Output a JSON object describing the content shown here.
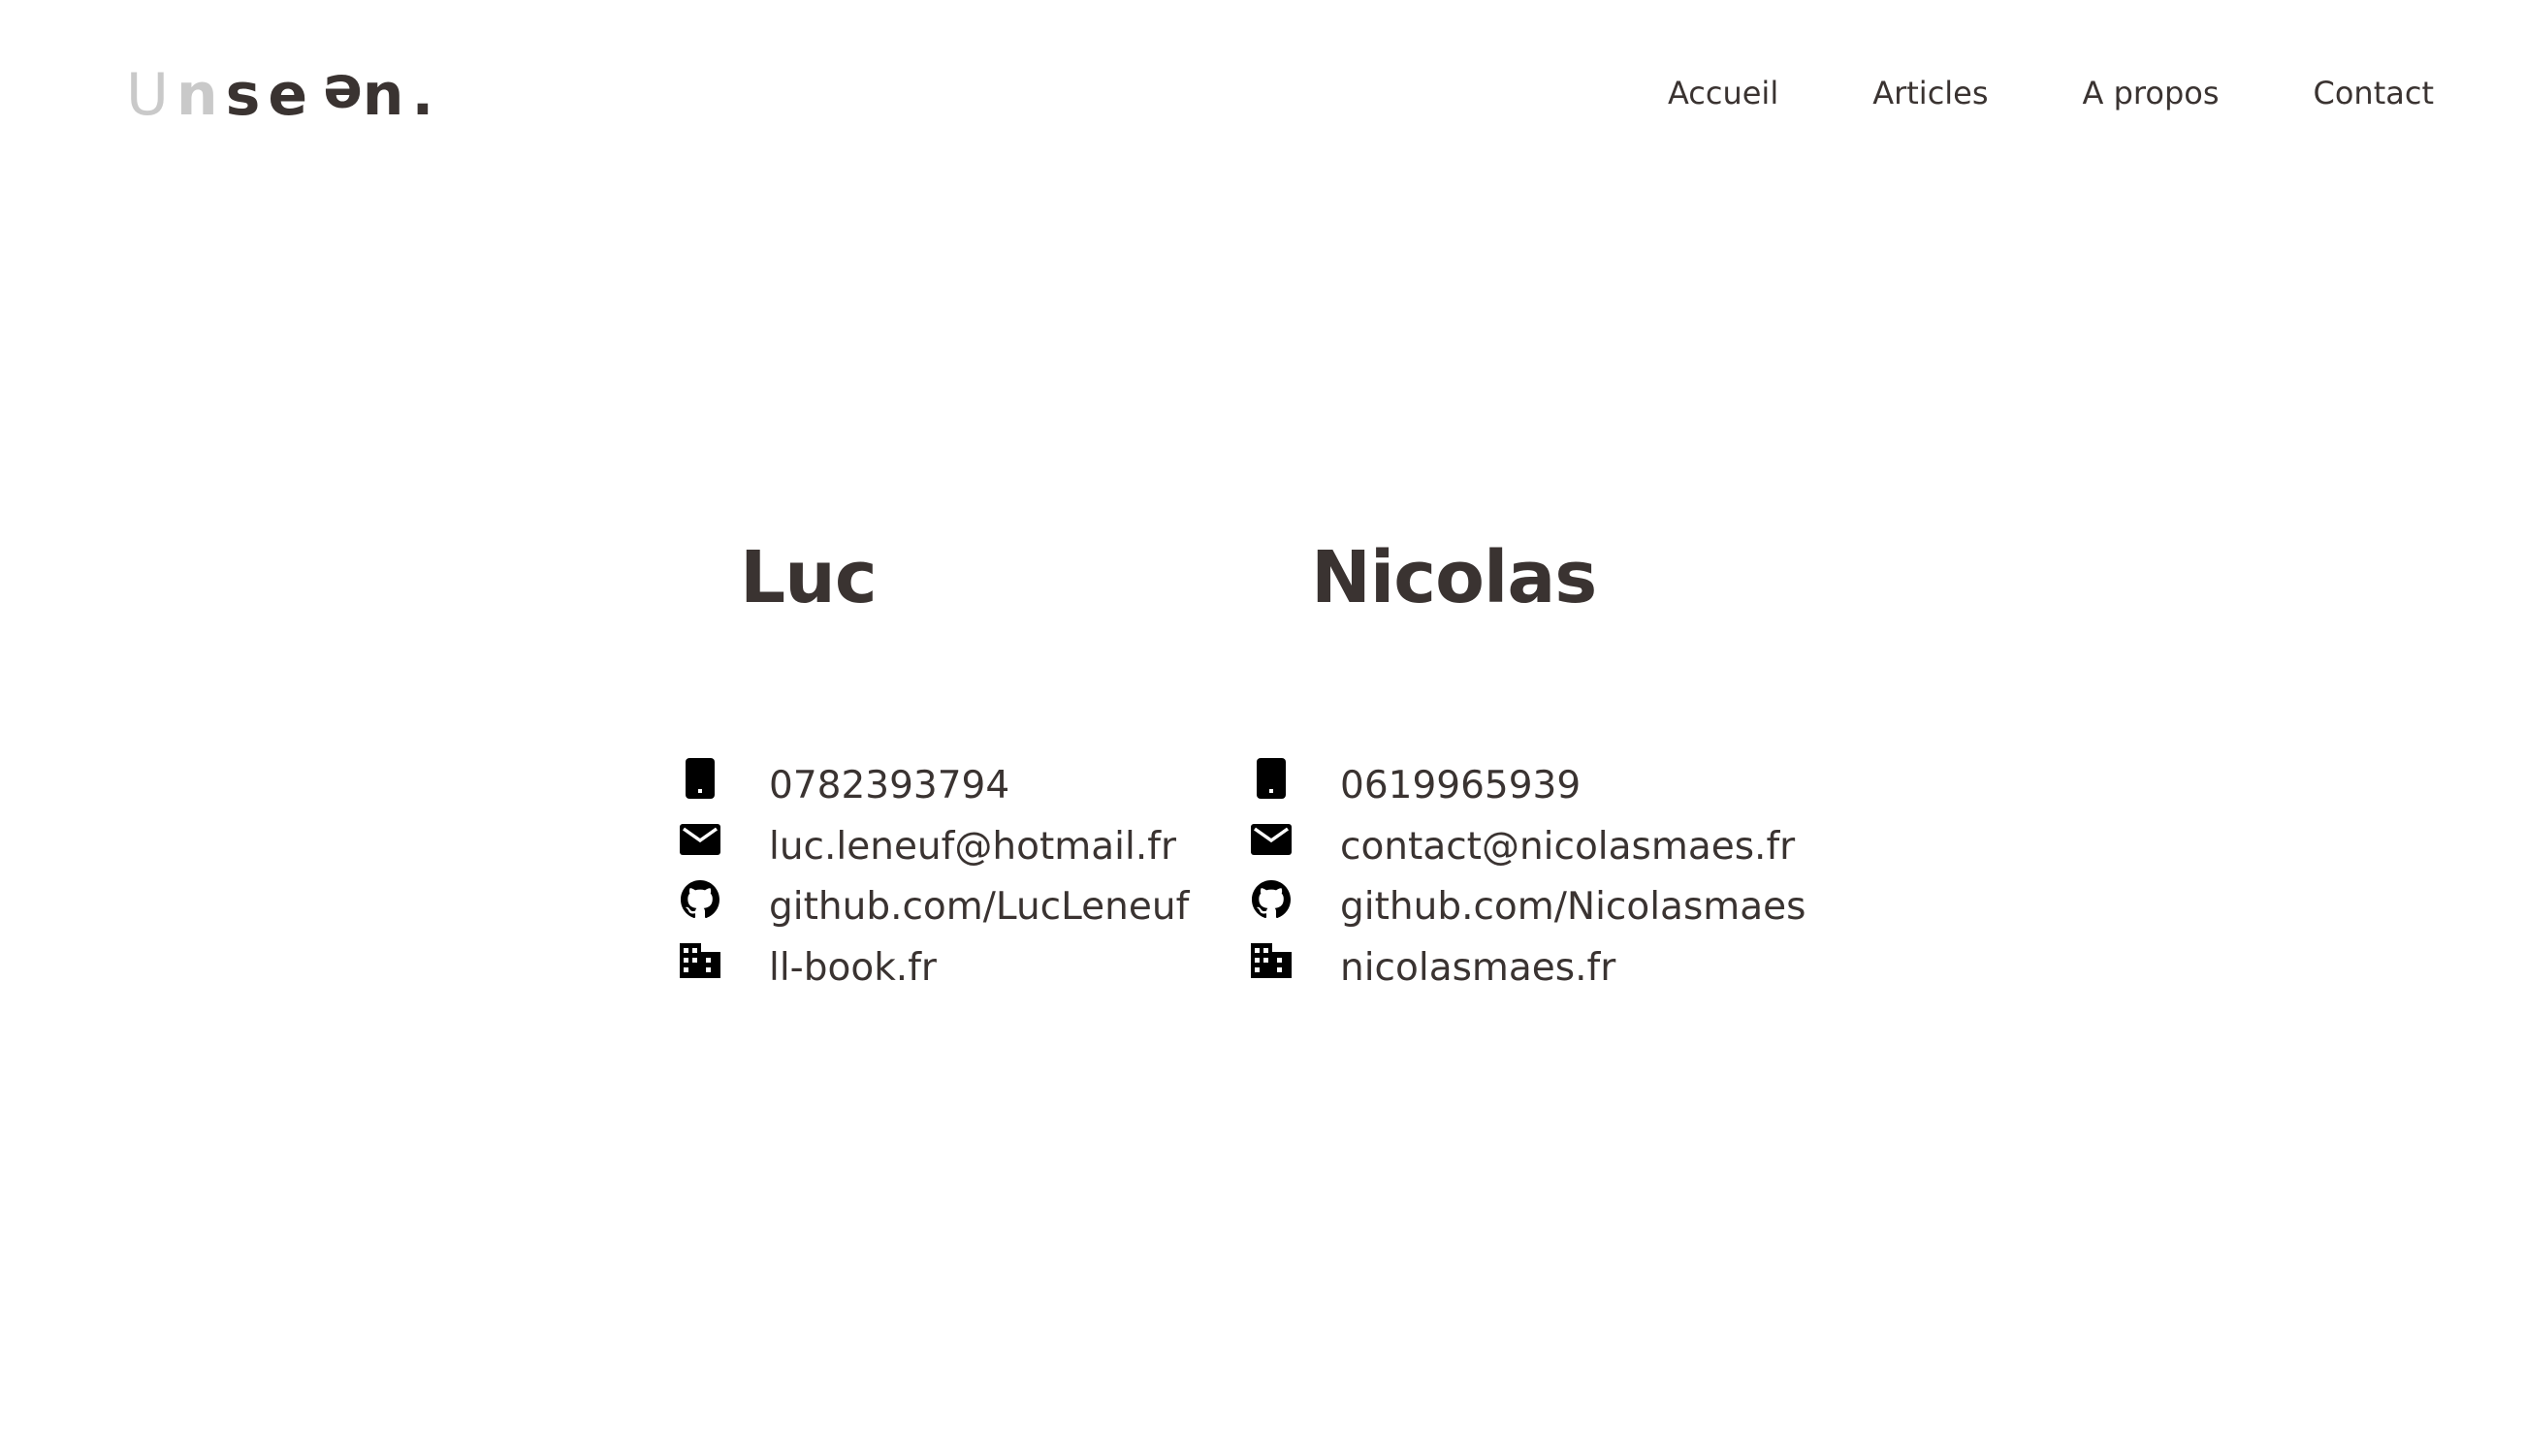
{
  "header": {
    "logo_text": "Unseen.",
    "nav": [
      {
        "label": "Accueil"
      },
      {
        "label": "Articles"
      },
      {
        "label": "A propos"
      },
      {
        "label": "Contact"
      }
    ]
  },
  "people": [
    {
      "name": "Luc",
      "phone": "0782393794",
      "email": "luc.leneuf@hotmail.fr",
      "github": "github.com/LucLeneuf",
      "website": "ll-book.fr"
    },
    {
      "name": "Nicolas",
      "phone": "0619965939",
      "email": "contact@nicolasmaes.fr",
      "github": "github.com/Nicolasmaes",
      "website": "nicolasmaes.fr"
    }
  ],
  "icons": {
    "phone": "phone-icon",
    "email": "envelope-icon",
    "github": "github-icon",
    "website": "building-icon"
  },
  "colors": {
    "text": "#3a3331",
    "logo_light": "#c9c9c9",
    "icon": "#000000",
    "background": "#ffffff"
  }
}
